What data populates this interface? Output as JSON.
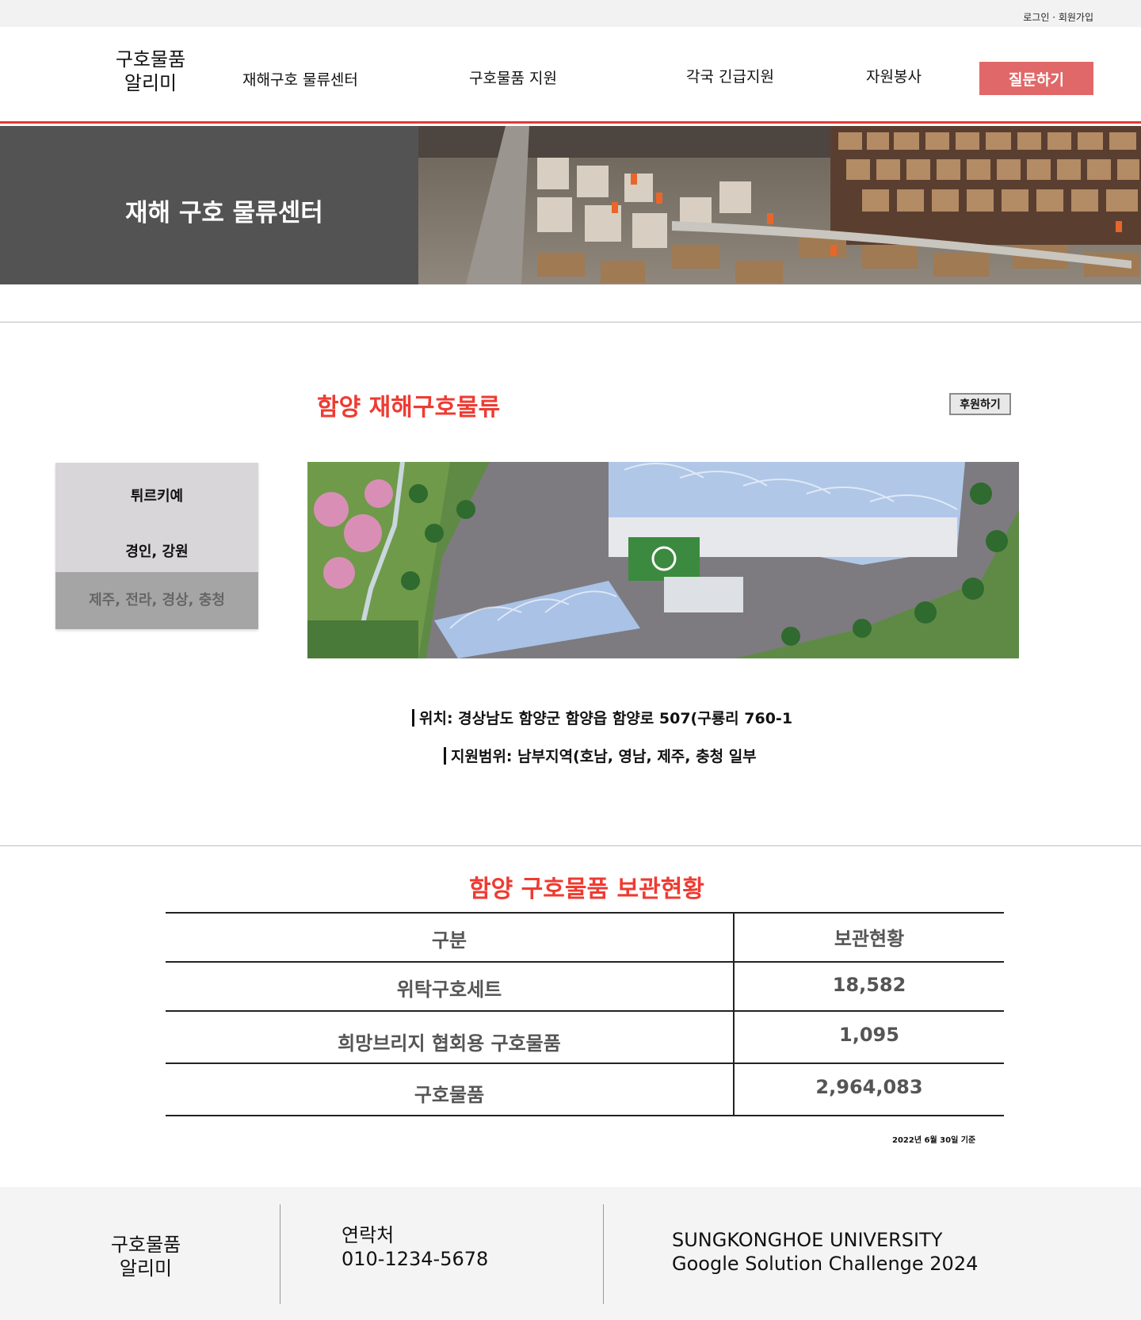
{
  "top_links": {
    "auth": "로그인 · 회원가입"
  },
  "header": {
    "logo_line1": "구호물품",
    "logo_line2": "알리미",
    "nav": [
      "재해구호 물류센터",
      "구호물품 지원",
      "각국 긴급지원",
      "자원봉사"
    ],
    "ask_button": "질문하기"
  },
  "banner": {
    "title": "재해 구호 물류센터"
  },
  "center": {
    "title": "함양 재해구호물류",
    "donate_button": "후원하기",
    "regions": [
      "튀르키예",
      "경인, 강원",
      "제주, 전라, 경상, 충청"
    ],
    "location": "위치: 경상남도 함양군 함양읍 함양로 507(구룡리 760-1",
    "coverage": "지원범위: 남부지역(호남, 영남, 제주, 충청 일부"
  },
  "storage": {
    "title": "함양 구호물품 보관현황",
    "headers": [
      "구분",
      "보관현황"
    ],
    "rows": [
      {
        "category": "위탁구호세트",
        "amount": "18,582"
      },
      {
        "category": "희망브리지 협회용 구호물품",
        "amount": "1,095"
      },
      {
        "category": "구호물품",
        "amount": "2,964,083"
      }
    ],
    "note": "2022년 6월 30일 기준"
  },
  "footer": {
    "logo_line1": "구호물품",
    "logo_line2": "알리미",
    "contact_label": "연락처",
    "contact_phone": "010-1234-5678",
    "univ_line1": "SUNGKONGHOE UNIVERSITY",
    "univ_line2": "Google Solution Challenge 2024"
  },
  "colors": {
    "accent_red": "#ee3b32",
    "ask_button_bg": "#e06868",
    "banner_bg": "#535353",
    "side_menu_bg": "#d8d6d8",
    "side_menu_active_bg": "#a5a5a5",
    "footer_bg": "#f4f4f4"
  }
}
